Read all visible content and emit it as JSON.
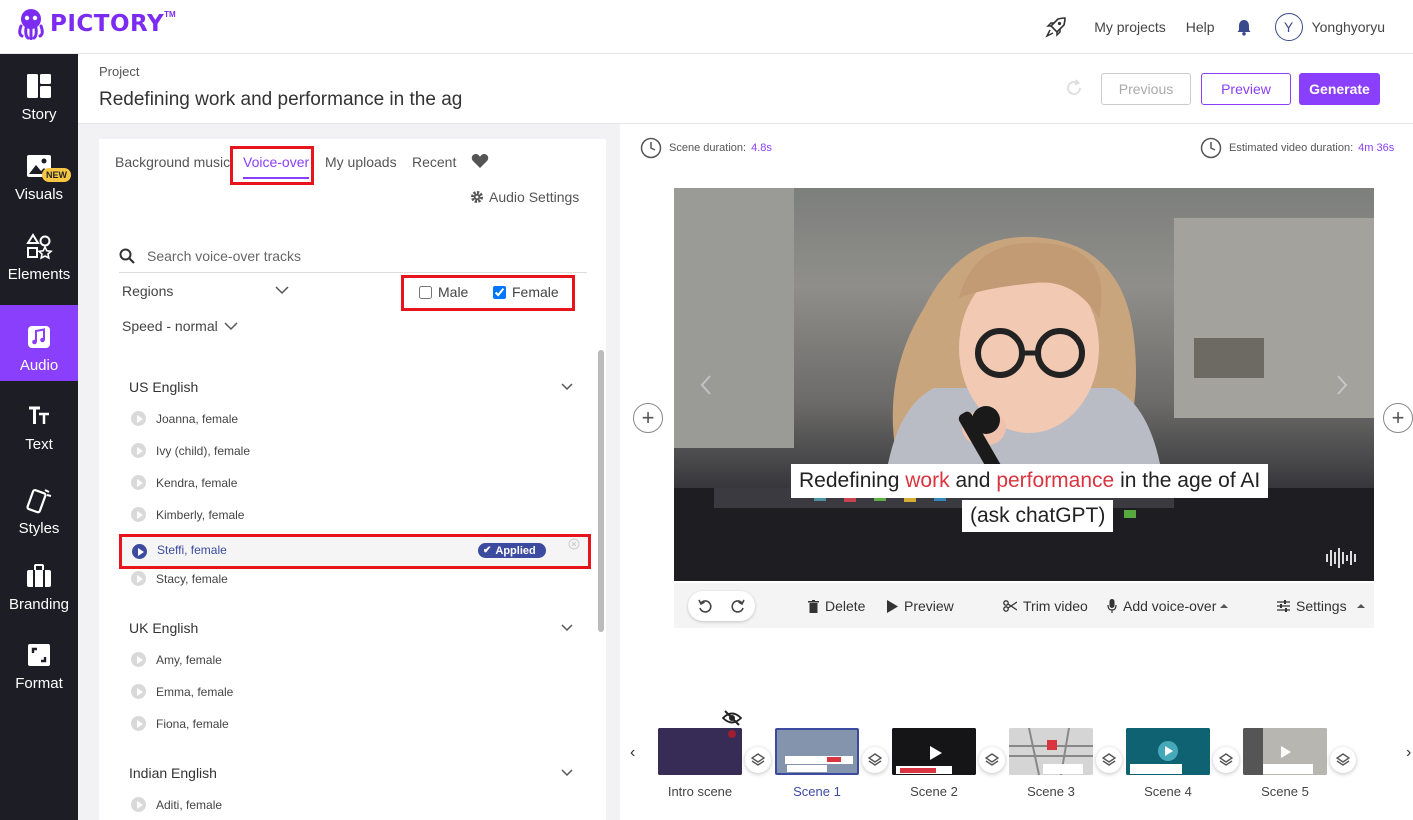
{
  "app": {
    "name": "PICTORY",
    "tm": "TM"
  },
  "topnav": {
    "my_projects": "My projects",
    "help": "Help",
    "avatar_initial": "Y",
    "username": "Yonghyoryu"
  },
  "sidebar": {
    "items": [
      {
        "label": "Story",
        "icon": "story-icon"
      },
      {
        "label": "Visuals",
        "icon": "image-icon"
      },
      {
        "label": "Elements",
        "icon": "shapes-icon"
      },
      {
        "label": "Audio",
        "icon": "music-icon"
      },
      {
        "label": "Text",
        "icon": "text-icon"
      },
      {
        "label": "Styles",
        "icon": "styles-icon"
      },
      {
        "label": "Branding",
        "icon": "briefcase-icon"
      },
      {
        "label": "Format",
        "icon": "format-icon"
      }
    ],
    "new_badge": "NEW",
    "active": "Audio"
  },
  "project": {
    "label": "Project",
    "title": "Redefining work and performance in the ag",
    "buttons": {
      "previous": "Previous",
      "preview": "Preview",
      "generate": "Generate"
    }
  },
  "audio_panel": {
    "tabs": [
      "Background music",
      "Voice-over",
      "My uploads",
      "Recent"
    ],
    "active_tab": "Voice-over",
    "audio_settings": "Audio Settings",
    "search_placeholder": "Search voice-over tracks",
    "regions": "Regions",
    "speed": "Speed - normal",
    "gender": {
      "male": "Male",
      "female": "Female",
      "male_checked": false,
      "female_checked": true
    },
    "groups": [
      {
        "title": "US English",
        "voices": [
          "Joanna, female",
          "Ivy (child), female",
          "Kendra, female",
          "Kimberly, female",
          "Steffi, female",
          "Stacy, female"
        ]
      },
      {
        "title": "UK English",
        "voices": [
          "Amy, female",
          "Emma, female",
          "Fiona, female"
        ]
      },
      {
        "title": "Indian English",
        "voices": [
          "Aditi, female"
        ]
      }
    ],
    "applied_voice": "Steffi, female",
    "applied_label": "Applied"
  },
  "scene": {
    "duration_label": "Scene duration:",
    "duration_value": "4.8s",
    "estimated_label": "Estimated video duration:",
    "estimated_value": "4m 36s",
    "caption": {
      "p1": "Redefining ",
      "w1": "work",
      "p2": " and ",
      "w2": "performance",
      "p3": " in the age of AI",
      "line2": "(ask chatGPT)"
    },
    "toolbar": {
      "delete": "Delete",
      "preview": "Preview",
      "trim": "Trim video",
      "add_voice": "Add voice-over",
      "settings": "Settings"
    }
  },
  "timeline": {
    "scenes": [
      "Intro scene",
      "Scene 1",
      "Scene 2",
      "Scene 3",
      "Scene 4",
      "Scene 5"
    ],
    "selected": "Scene 1"
  },
  "colors": {
    "accent": "#8a3ffc",
    "sidebar": "#1d1d26",
    "highlight": "#e8141b",
    "applied": "#3c4ba0"
  }
}
